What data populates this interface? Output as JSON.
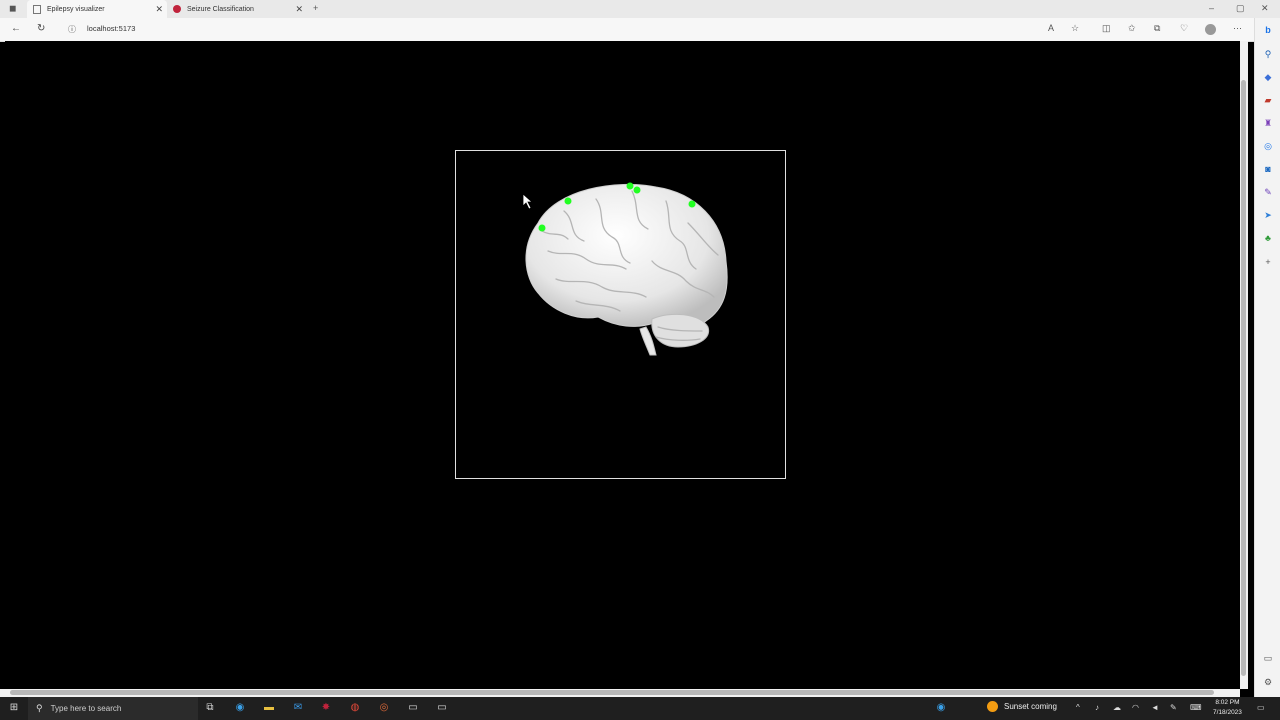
{
  "browser": {
    "tabs": [
      {
        "title": "Epilepsy visualizer",
        "active": true
      },
      {
        "title": "Seizure Classification",
        "active": false
      }
    ],
    "url": "localhost:5173"
  },
  "taskbar": {
    "search_placeholder": "Type here to search",
    "weather": "Sunset coming",
    "time": "8:02 PM",
    "date": "7/18/2023"
  },
  "colors": {
    "electrode": "#22ff22",
    "background": "#000000"
  }
}
